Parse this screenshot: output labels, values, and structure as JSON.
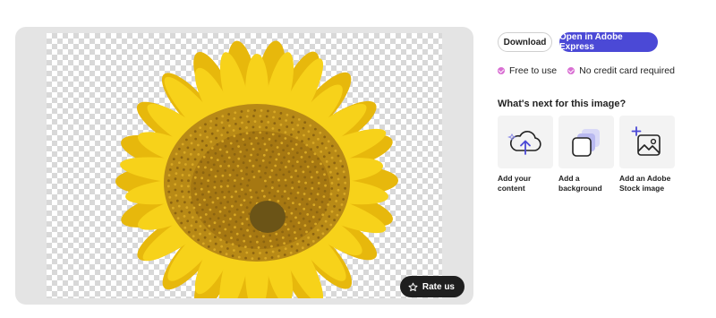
{
  "preview": {
    "rate_label": "Rate us"
  },
  "actions": {
    "download_label": "Download",
    "open_label": "Open in Adobe Express"
  },
  "features": [
    {
      "label": "Free to use"
    },
    {
      "label": "No credit card required"
    }
  ],
  "next_section": {
    "title": "What's next for this image?",
    "cards": [
      {
        "label": "Add your content",
        "icon": "cloud-upload-icon"
      },
      {
        "label": "Add a background",
        "icon": "layers-icon"
      },
      {
        "label": "Add an Adobe Stock image",
        "icon": "add-image-icon"
      }
    ]
  },
  "colors": {
    "accent": "#4b49d6",
    "check": "#d96fd3",
    "panel": "#e4e4e4",
    "petal": "#f7d21a",
    "petal_shade": "#e7b80c",
    "disc": "#b88a16",
    "disc_center": "#6b5417"
  }
}
